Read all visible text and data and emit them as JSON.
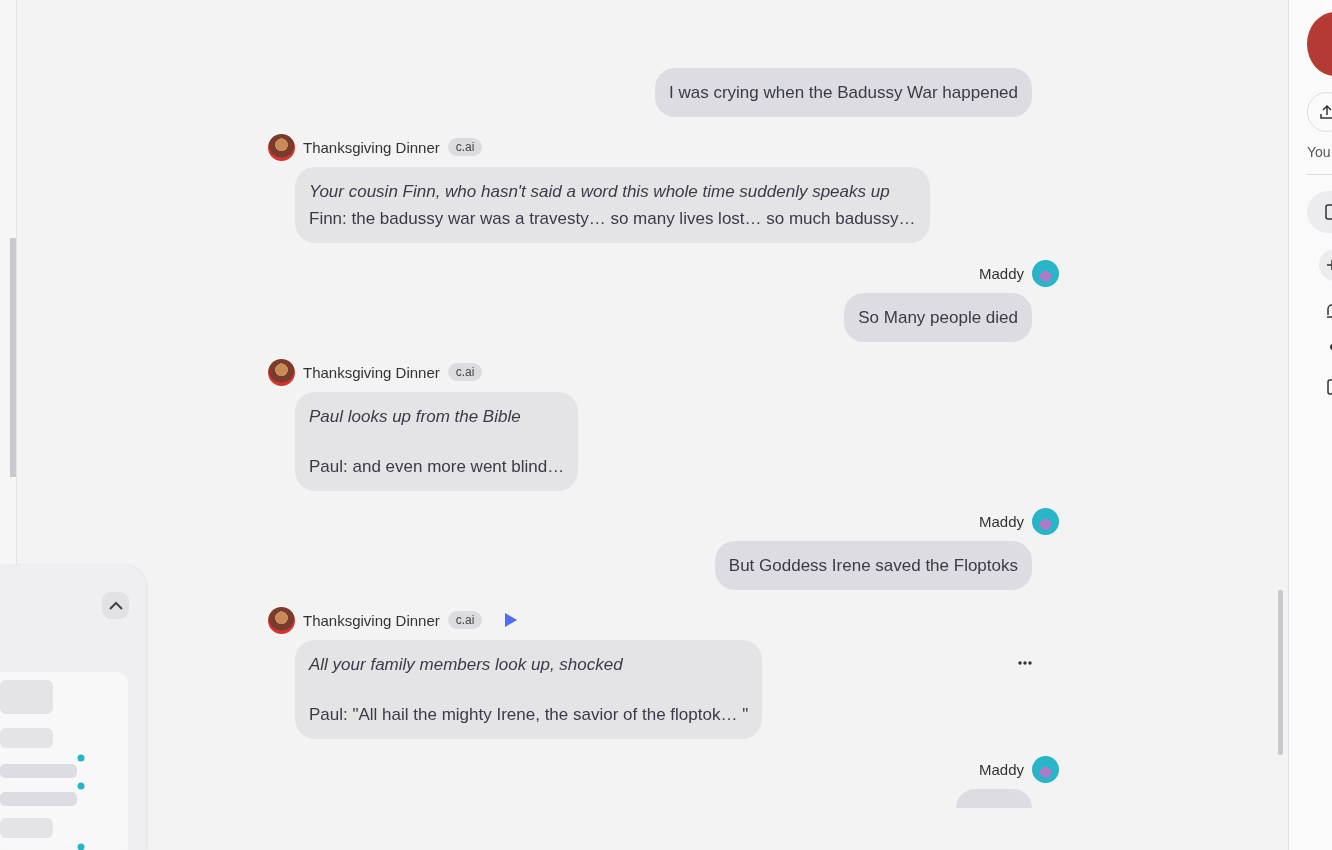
{
  "messages": [
    {
      "kind": "user",
      "paragraphs": [
        {
          "kind": "dialogue",
          "text": "I was crying when the Badussy War happened"
        }
      ]
    },
    {
      "kind": "bot",
      "name": "Thanksgiving Dinner",
      "tag": "c.ai",
      "spaced": false,
      "paragraphs": [
        {
          "kind": "narration",
          "text": "Your cousin Finn, who hasn't said a word this whole time suddenly speaks up"
        },
        {
          "kind": "dialogue",
          "text": "Finn: the badussy war was a travesty… so many lives lost… so much badussy…"
        }
      ]
    },
    {
      "kind": "user",
      "name": "Maddy",
      "paragraphs": [
        {
          "kind": "dialogue",
          "text": "So Many people died"
        }
      ]
    },
    {
      "kind": "bot",
      "name": "Thanksgiving Dinner",
      "tag": "c.ai",
      "spaced": true,
      "paragraphs": [
        {
          "kind": "narration",
          "text": "Paul looks up from the Bible"
        },
        {
          "kind": "dialogue",
          "text": "Paul: and even more went blind…"
        }
      ]
    },
    {
      "kind": "user",
      "name": "Maddy",
      "paragraphs": [
        {
          "kind": "dialogue",
          "text": "But Goddess Irene saved the Floptoks"
        }
      ]
    },
    {
      "kind": "bot",
      "name": "Thanksgiving Dinner",
      "tag": "c.ai",
      "play_button": true,
      "menu": true,
      "spaced": true,
      "paragraphs": [
        {
          "kind": "narration",
          "text": "All your family members look up, shocked"
        },
        {
          "kind": "dialogue",
          "text": "Paul: \"All hail the mighty Irene, the savior of the floptok… \""
        }
      ]
    },
    {
      "kind": "user",
      "name": "Maddy"
    }
  ],
  "right_panel": {
    "label": "You"
  }
}
